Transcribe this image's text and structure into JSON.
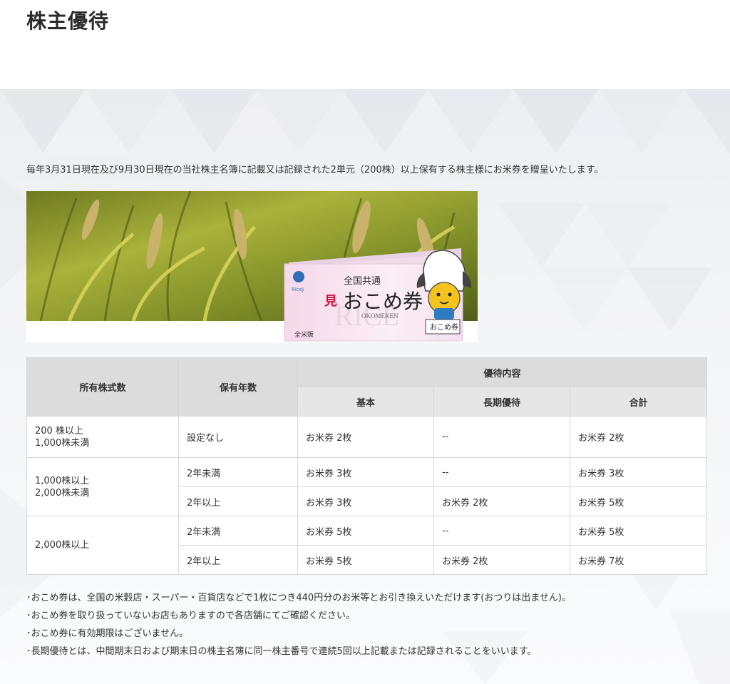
{
  "page_title": "株主優待",
  "intro": "毎年3月31日現在及び9月30日現在の当社株主名簿に記載又は記録された2単元（200株）以上保有する株主様にお米券を贈呈いたします。",
  "ticket": {
    "header": "全国共通",
    "mihon": "見",
    "name": "おこめ券",
    "romaji": "OKOMEKEN",
    "issuer_mark": "RiceJ",
    "edition": "全米販",
    "bg_word": "RICE",
    "sign": "おこめ券"
  },
  "table": {
    "headers": {
      "shares": "所有株式数",
      "years": "保有年数",
      "benefit": "優待内容",
      "basic": "基本",
      "long_term": "長期優待",
      "total": "合計"
    },
    "rows": [
      {
        "shares": [
          "200 株以上",
          "1,000株未満"
        ],
        "years": "設定なし",
        "basic": "お米券 2枚",
        "long_term": "--",
        "total": "お米券 2枚"
      },
      {
        "shares": [
          "1,000株以上",
          "2,000株未満"
        ],
        "years": "2年未満",
        "basic": "お米券 3枚",
        "long_term": "--",
        "total": "お米券 3枚"
      },
      {
        "years": "2年以上",
        "basic": "お米券 3枚",
        "long_term": "お米券 2枚",
        "total": "お米券 5枚"
      },
      {
        "shares": [
          "2,000株以上"
        ],
        "years": "2年未満",
        "basic": "お米券 5枚",
        "long_term": "--",
        "total": "お米券 5枚"
      },
      {
        "years": "2年以上",
        "basic": "お米券 5枚",
        "long_term": "お米券 2枚",
        "total": "お米券 7枚"
      }
    ]
  },
  "notes": [
    "･おこめ券は、全国の米穀店・スーパー・百貨店などで1枚につき440円分のお米等とお引き換えいただけます(おつりは出ません)。",
    "･おこめ券を取り扱っていないお店もありますので各店舗にてご確認ください。",
    "･おこめ券に有効期限はございません。",
    "･長期優待とは、中間期末日および期末日の株主名簿に同一株主番号で連続5回以上記載または記録されることをいいます。"
  ],
  "colors": {
    "header_bg": "#dcdcdc",
    "border": "#d6d6d6",
    "text": "#333333",
    "mihon_red": "#d0103a"
  }
}
